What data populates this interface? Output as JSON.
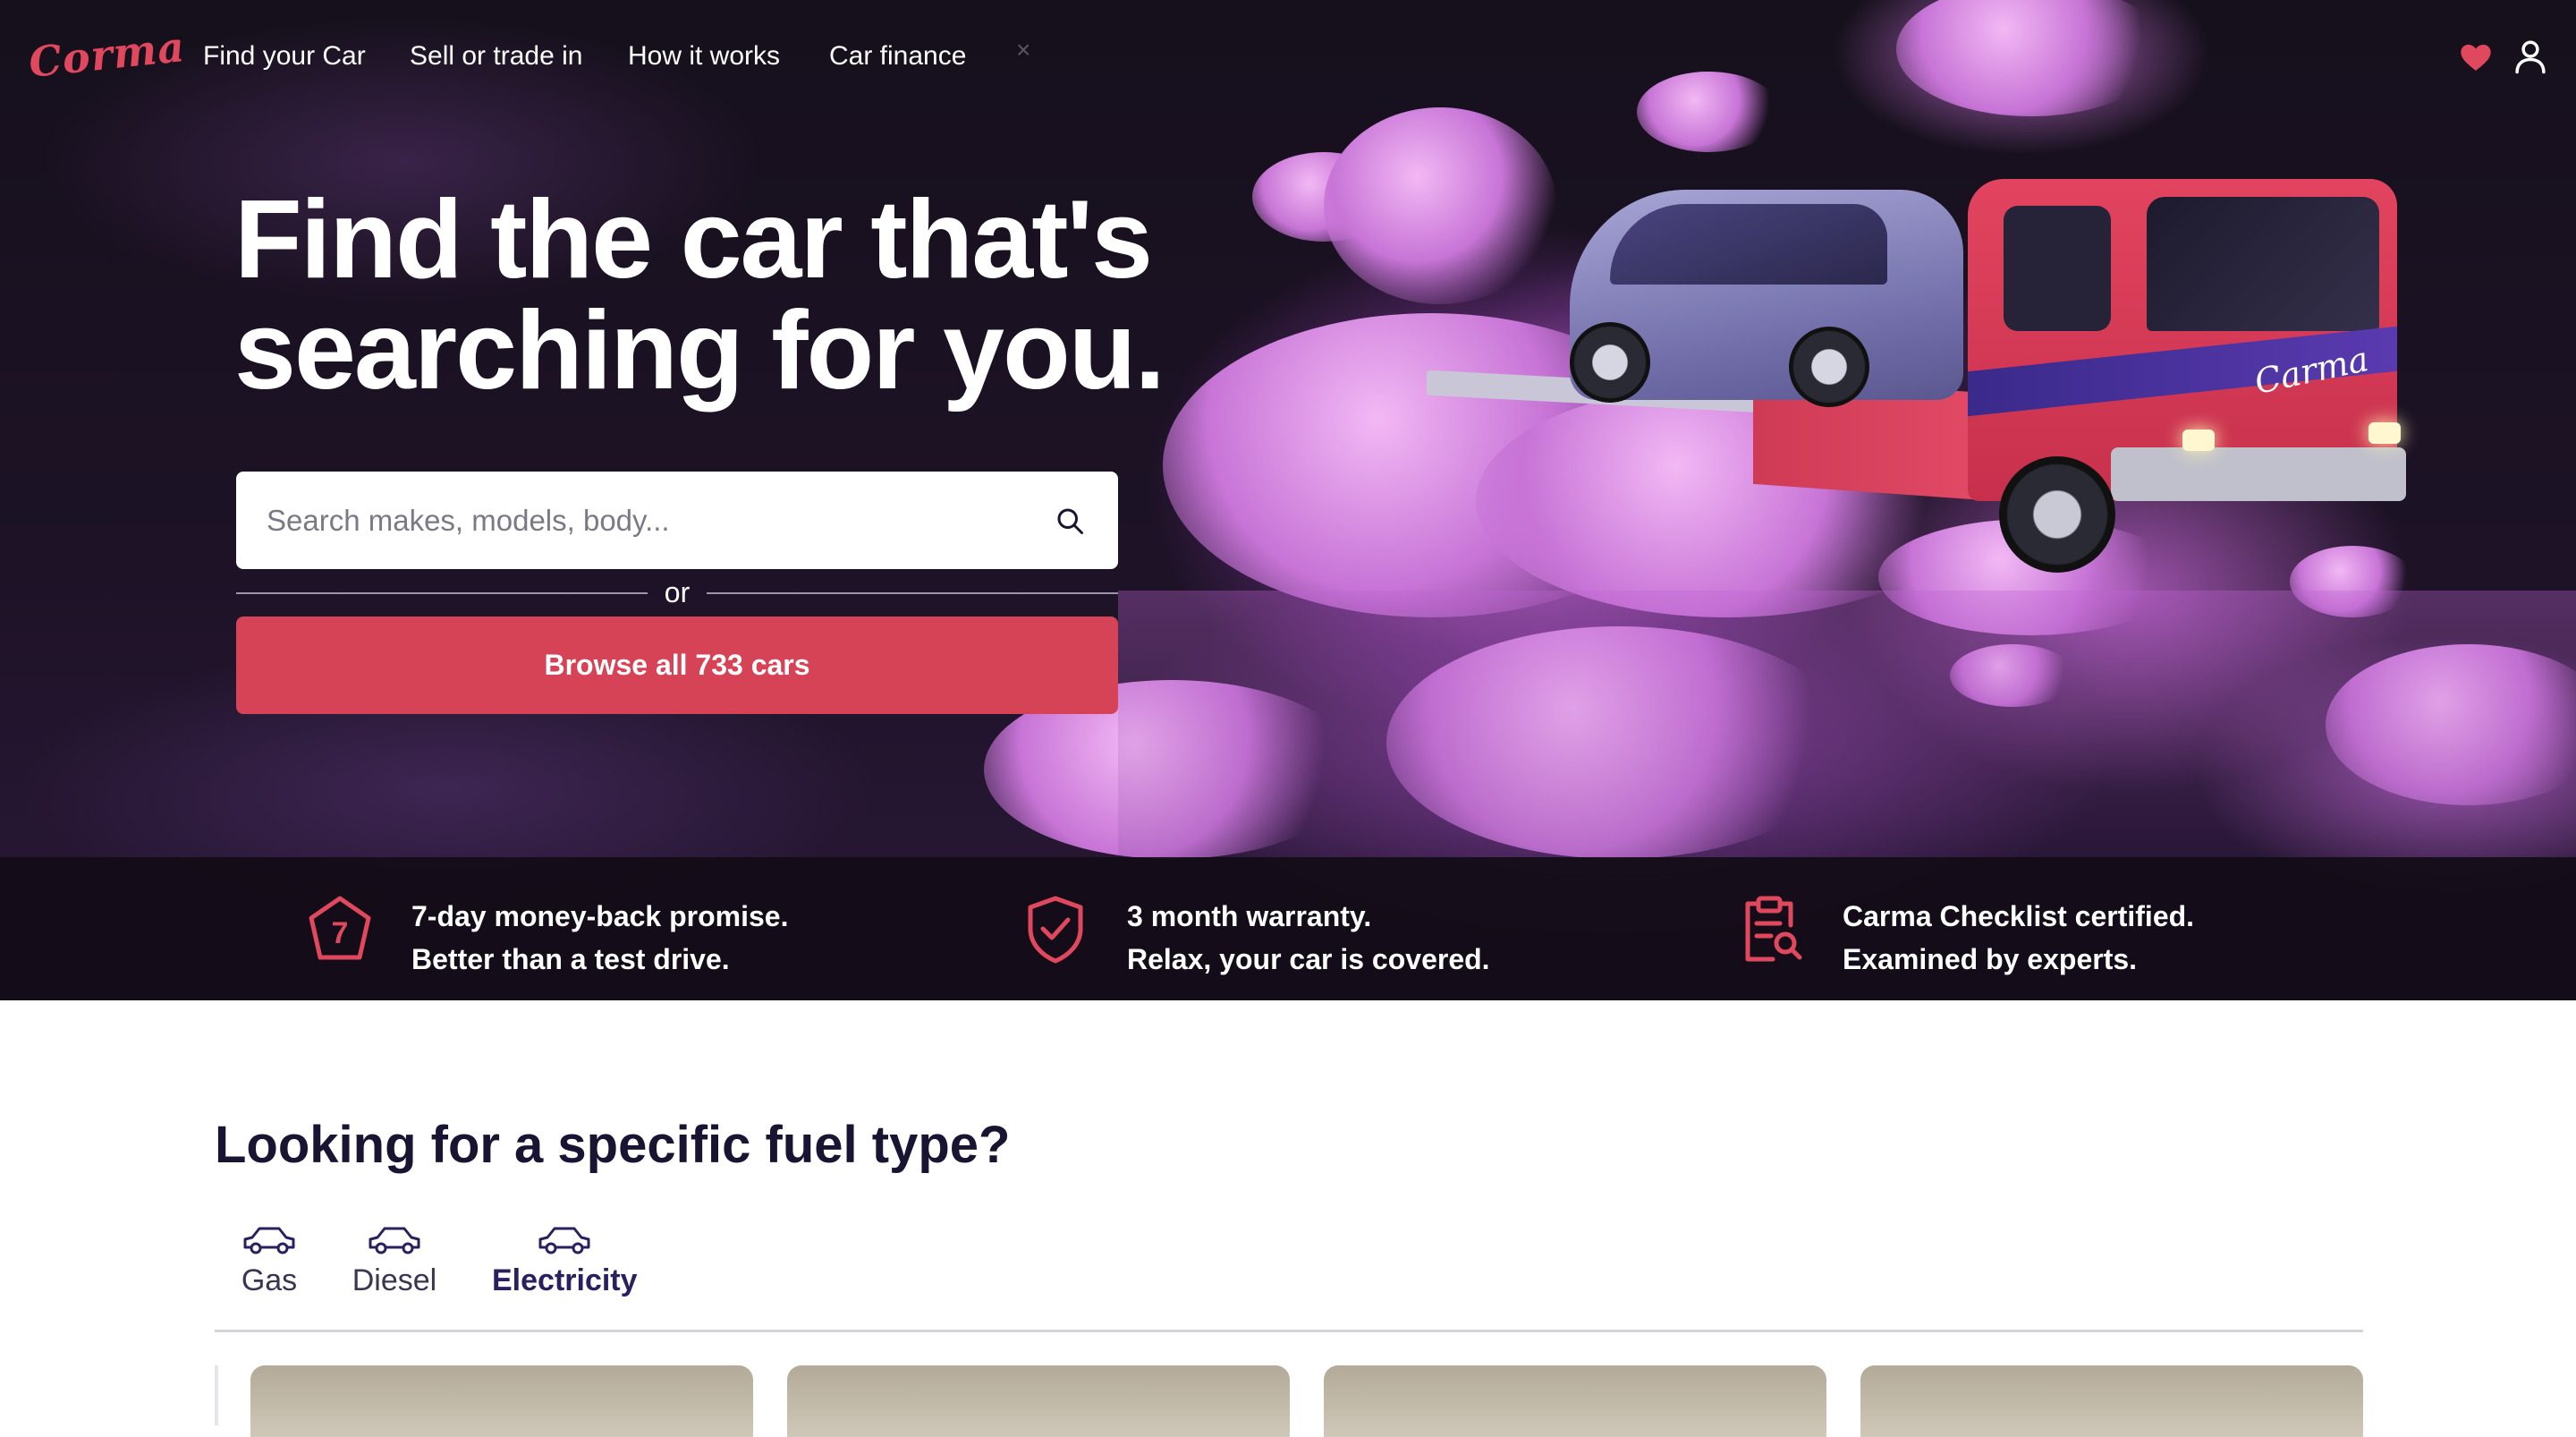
{
  "brand": {
    "logo_text": "Corma"
  },
  "nav": {
    "links": [
      {
        "label": "Find your Car"
      },
      {
        "label": "Sell or trade in"
      },
      {
        "label": "How it works"
      },
      {
        "label": "Car finance"
      }
    ],
    "close_glyph": "×",
    "icons": [
      "heart-icon",
      "user-icon"
    ],
    "heart_color": "#e0485e"
  },
  "hero": {
    "headline_line1": "Find the car that's",
    "headline_line2": "searching for you.",
    "search": {
      "placeholder": "Search makes, models, body...",
      "value": ""
    },
    "divider_text": "or",
    "browse_button": "Browse all 733 cars",
    "truck_logo": "Carma"
  },
  "promises": [
    {
      "icon": "seven-badge-icon",
      "line1": "7-day money-back promise.",
      "line2": "Better than a test drive."
    },
    {
      "icon": "shield-check-icon",
      "line1": "3 month warranty.",
      "line2": "Relax, your car is covered."
    },
    {
      "icon": "clipboard-search-icon",
      "line1": "Carma Checklist certified.",
      "line2": "Examined by experts."
    }
  ],
  "fuel": {
    "title": "Looking for a specific fuel type?",
    "tabs": [
      {
        "label": "Gas",
        "active": false
      },
      {
        "label": "Diesel",
        "active": false
      },
      {
        "label": "Electricity",
        "active": true
      }
    ]
  },
  "colors": {
    "accent": "#d64356",
    "dark": "#1a1433",
    "promise_icon": "#e0485e"
  }
}
